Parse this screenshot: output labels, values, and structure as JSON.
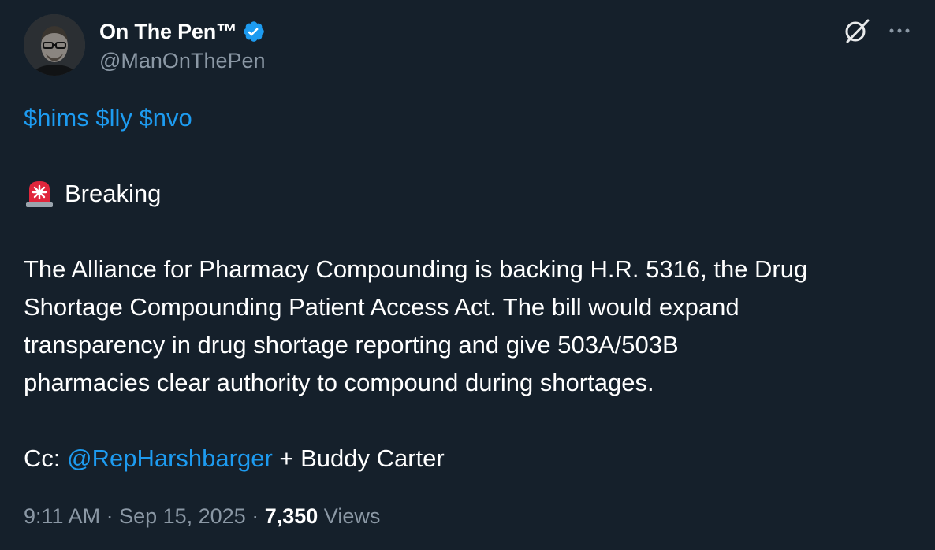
{
  "author": {
    "display_name": "On The Pen™",
    "handle": "@ManOnThePen",
    "verified": true
  },
  "tweet": {
    "cashtags": [
      "$hims",
      "$lly",
      "$nvo"
    ],
    "breaking_label": "Breaking",
    "body_lines": [
      "The Alliance for Pharmacy Compounding is backing H.R. 5316, the Drug",
      "Shortage Compounding Patient Access Act. The bill would expand",
      "transparency in drug shortage reporting and give 503A/503B",
      "pharmacies clear authority to compound during shortages."
    ],
    "cc_prefix": "Cc: ",
    "cc_mention": "@RepHarshbarger",
    "cc_suffix": " + Buddy Carter"
  },
  "meta": {
    "time": "9:11 AM",
    "separator": " · ",
    "date": "Sep 15, 2025",
    "views_count": "7,350",
    "views_label": " Views"
  },
  "icons": {
    "verified": "verified-badge-icon",
    "grok": "grok-icon",
    "more": "more-options-icon",
    "siren": "rotating-light-icon"
  },
  "colors": {
    "background": "#15202b",
    "link": "#1d9bf0",
    "secondary_text": "#8b98a5",
    "primary_text": "#ffffff"
  }
}
